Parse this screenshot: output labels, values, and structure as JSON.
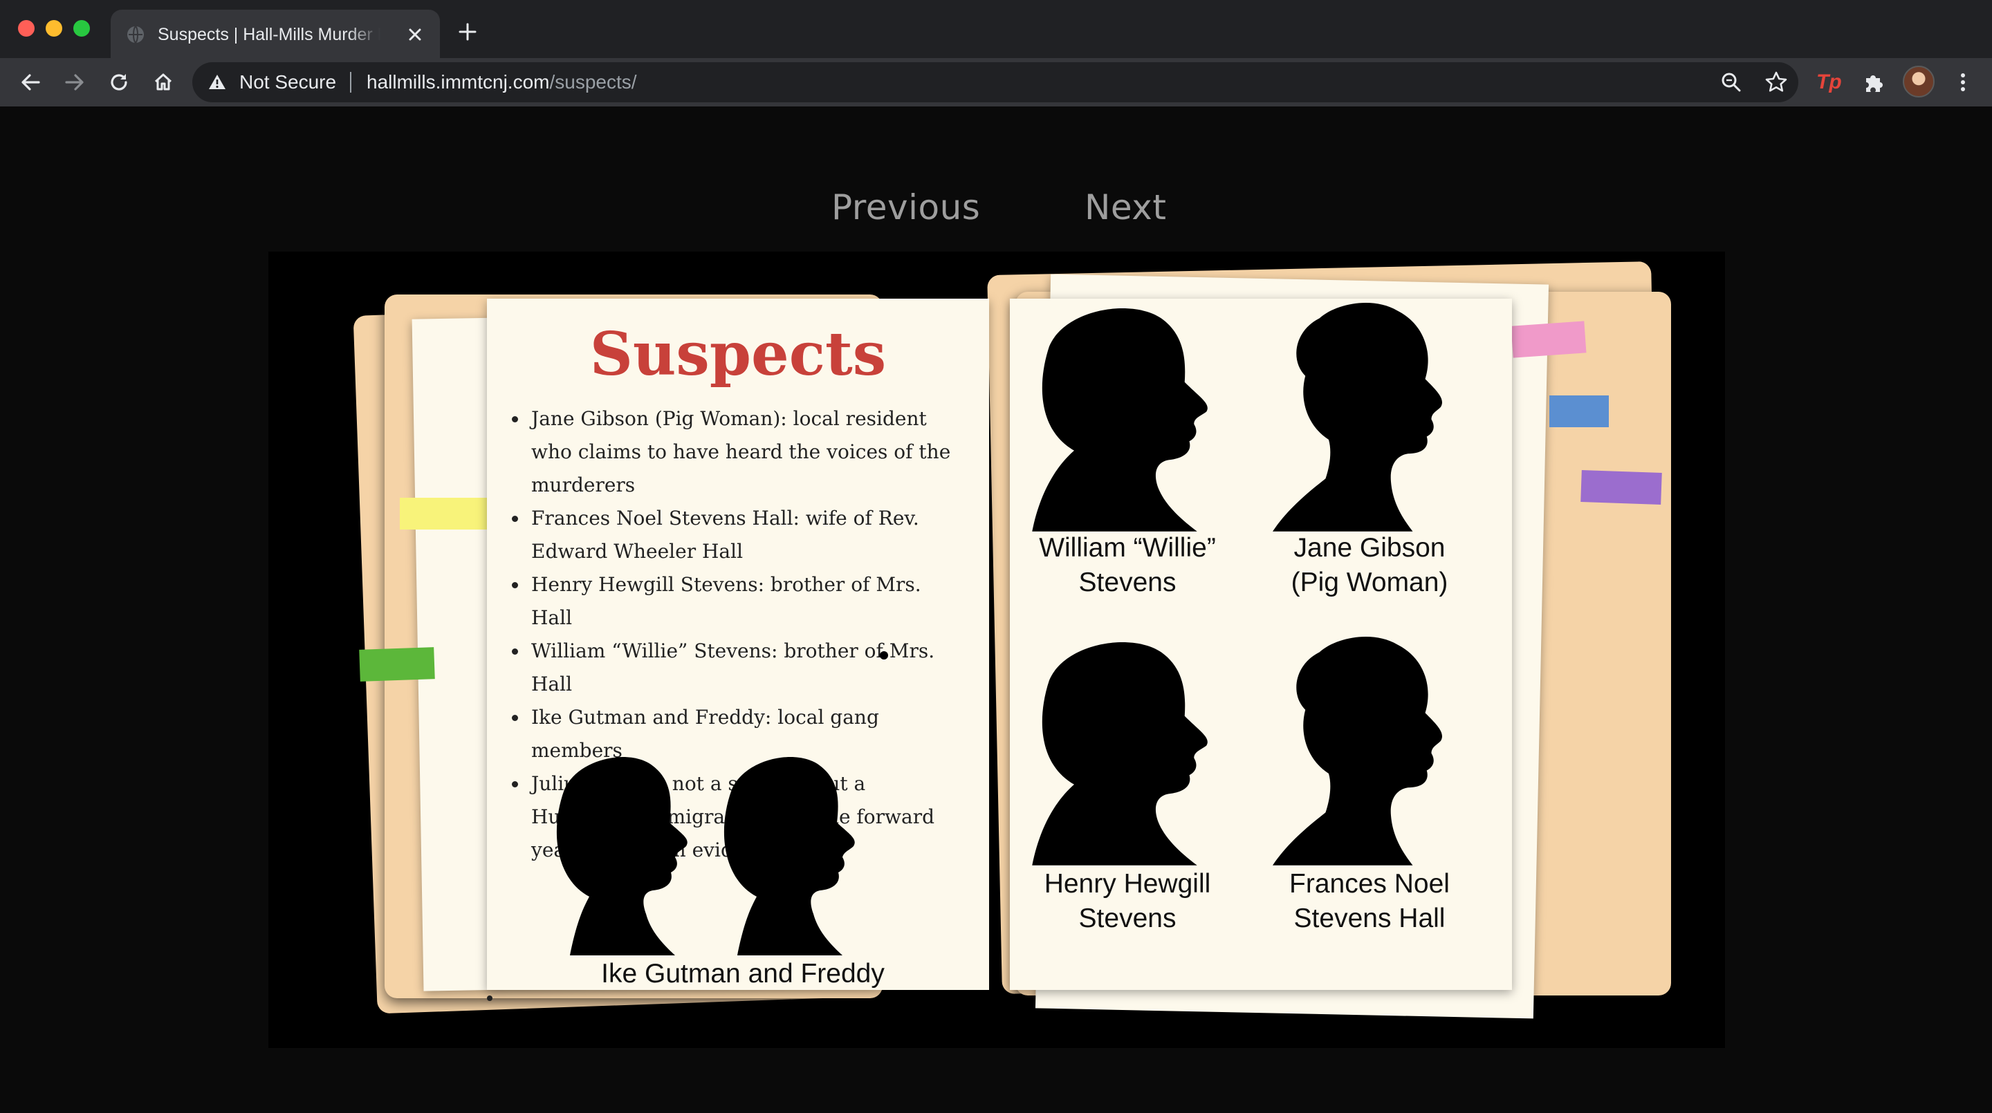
{
  "browser": {
    "tab_title": "Suspects | Hall-Mills Murder Mystery",
    "security_label": "Not Secure",
    "url_host": "hallmills.immtcnj.com",
    "url_path": "/suspects/",
    "extension_label": "Tp"
  },
  "nav": {
    "previous": "Previous",
    "next": "Next"
  },
  "book": {
    "title": "Suspects",
    "suspects": [
      "Jane Gibson (Pig Woman): local resident who claims to have heard the voices of the murderers",
      "Frances Noel Stevens Hall: wife of Rev. Edward Wheeler Hall",
      "Henry Hewgill Stevens: brother of Mrs. Hall",
      "William “Willie” Stevens: brother of Mrs. Hall",
      "Ike Gutman and Freddy: local gang members",
      "Julius Bolyog: not a suspect, but a Hungarian immigrant who came forward years later with evidence"
    ],
    "portraits": {
      "gutman_freddy": "Ike Gutman and Freddy",
      "willie_line1": "William “Willie”",
      "willie_line2": "Stevens",
      "jane_line1": "Jane Gibson",
      "jane_line2": "(Pig Woman)",
      "henry_line1": "Henry Hewgill",
      "henry_line2": "Stevens",
      "frances_line1": "Frances Noel",
      "frances_line2": "Stevens Hall"
    }
  },
  "colors": {
    "title_red": "#c8413a",
    "folder": "#f5d3a7",
    "paper": "#fdf9ec",
    "tape_yellow": "#f8f37a",
    "tape_green": "#5cb73a",
    "tape_pink": "#f09ac9",
    "tape_blue": "#5b8fd1",
    "tape_purple": "#9b6dce"
  }
}
